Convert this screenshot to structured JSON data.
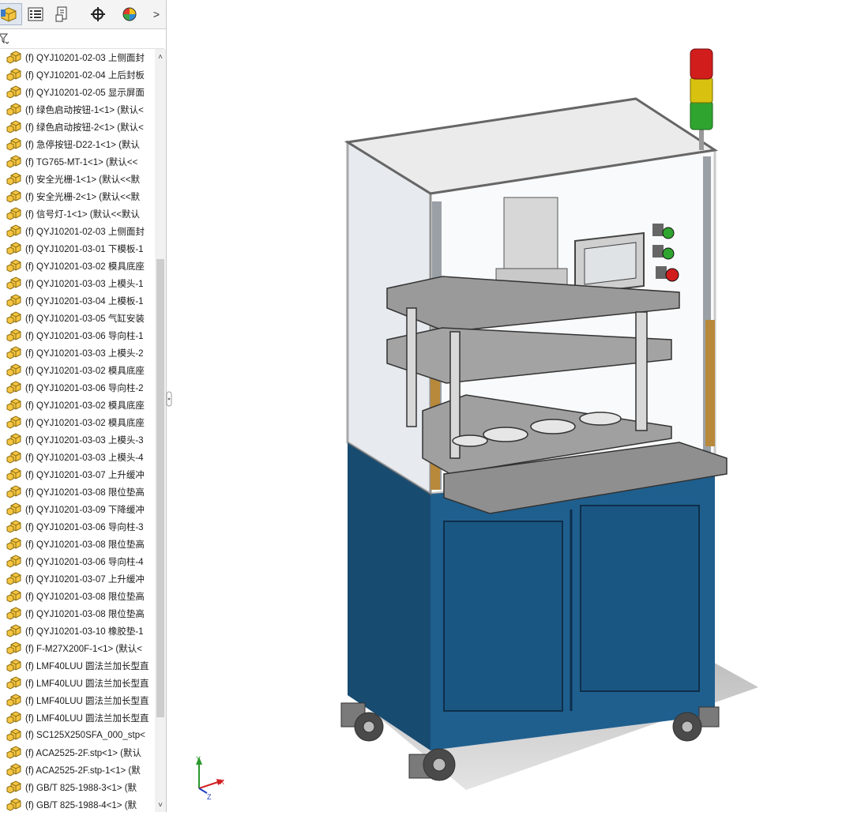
{
  "panel": {
    "tabs": [
      {
        "icon": "feature-manager-icon"
      },
      {
        "icon": "property-manager-icon"
      },
      {
        "icon": "configuration-manager-icon"
      },
      {
        "icon": "dimxpert-icon"
      },
      {
        "icon": "display-manager-icon"
      }
    ],
    "more_label": ">",
    "filter_icon": "filter-icon",
    "items": [
      "(f) QYJ10201-02-03 上侧面封",
      "(f) QYJ10201-02-04 上后封板",
      "(f) QYJ10201-02-05 显示屏面",
      "(f) 绿色启动按钮-1<1> (默认<",
      "(f) 绿色启动按钮-2<1> (默认<",
      "(f) 急停按钮-D22-1<1> (默认",
      "(f) TG765-MT-1<1> (默认<<",
      "(f) 安全光栅-1<1> (默认<<默",
      "(f) 安全光栅-2<1> (默认<<默",
      "(f) 信号灯-1<1> (默认<<默认",
      "(f) QYJ10201-02-03 上侧面封",
      "(f) QYJ10201-03-01 下模板-1",
      "(f) QYJ10201-03-02 模具底座",
      "(f) QYJ10201-03-03 上模头-1",
      "(f) QYJ10201-03-04 上模板-1",
      "(f) QYJ10201-03-05 气缸安装",
      "(f) QYJ10201-03-06 导向柱-1",
      "(f) QYJ10201-03-03 上模头-2",
      "(f) QYJ10201-03-02 模具底座",
      "(f) QYJ10201-03-06 导向柱-2",
      "(f) QYJ10201-03-02 模具底座",
      "(f) QYJ10201-03-02 模具底座",
      "(f) QYJ10201-03-03 上模头-3",
      "(f) QYJ10201-03-03 上模头-4",
      "(f) QYJ10201-03-07 上升缓冲",
      "(f) QYJ10201-03-08 限位垫高",
      "(f) QYJ10201-03-09 下降缓冲",
      "(f) QYJ10201-03-06 导向柱-3",
      "(f) QYJ10201-03-08 限位垫高",
      "(f) QYJ10201-03-06 导向柱-4",
      "(f) QYJ10201-03-07 上升缓冲",
      "(f) QYJ10201-03-08 限位垫高",
      "(f) QYJ10201-03-08 限位垫高",
      "(f) QYJ10201-03-10 橡胶垫-1",
      "(f) F-M27X200F-1<1> (默认<",
      "(f) LMF40LUU 圆法兰加长型直",
      "(f) LMF40LUU 圆法兰加长型直",
      "(f) LMF40LUU 圆法兰加长型直",
      "(f) LMF40LUU 圆法兰加长型直",
      "(f) SC125X250SFA_000_stp<",
      "(f) ACA2525-2F.stp<1> (默认",
      "(f) ACA2525-2F.stp-1<1> (默",
      "(f) GB/T 825-1988-3<1> (默",
      "(f) GB/T 825-1988-4<1> (默"
    ]
  },
  "triad": {
    "x_label": "X",
    "y_label": "Y",
    "z_label": "Z"
  },
  "colors": {
    "cabinet": "#1f5f8e",
    "frame": "#b9bdc2",
    "plate": "#9a9a9a",
    "light_red": "#d21d1d",
    "light_yellow": "#d8c20f",
    "light_green": "#2fa52f"
  }
}
